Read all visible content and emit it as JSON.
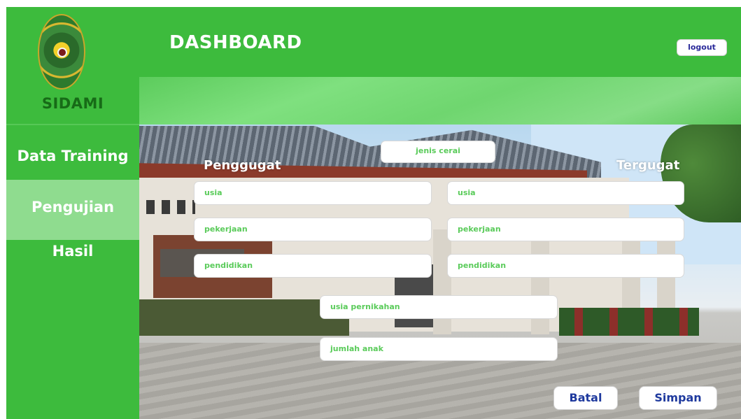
{
  "app": {
    "brand": "SIDAMI"
  },
  "sidebar": {
    "items": [
      {
        "label": "Data Training"
      },
      {
        "label": "Pengujian"
      },
      {
        "label": "Hasil"
      }
    ]
  },
  "header": {
    "title": "DASHBOARD",
    "logout_label": "logout"
  },
  "form": {
    "jenis_cerai_placeholder": "jenis cerai",
    "penggugat": {
      "heading": "Penggugat",
      "usia_placeholder": "usia",
      "pekerjaan_placeholder": "pekerjaan",
      "pendidikan_placeholder": "pendidikan"
    },
    "tergugat": {
      "heading": "Tergugat",
      "usia_placeholder": "usia",
      "pekerjaan_placeholder": "pekerjaan",
      "pendidikan_placeholder": "pendidikan"
    },
    "usia_pernikahan_placeholder": "usia pernikahan",
    "jumlah_anak_placeholder": "jumlah anak",
    "batal_label": "Batal",
    "simpan_label": "Simpan"
  },
  "colors": {
    "primary_green": "#3dbb3d",
    "active_nav": "#8fdc8f",
    "field_text": "#5acb5a",
    "button_text": "#1f3a9e"
  },
  "icons": {
    "logo": "court-emblem-logo"
  }
}
